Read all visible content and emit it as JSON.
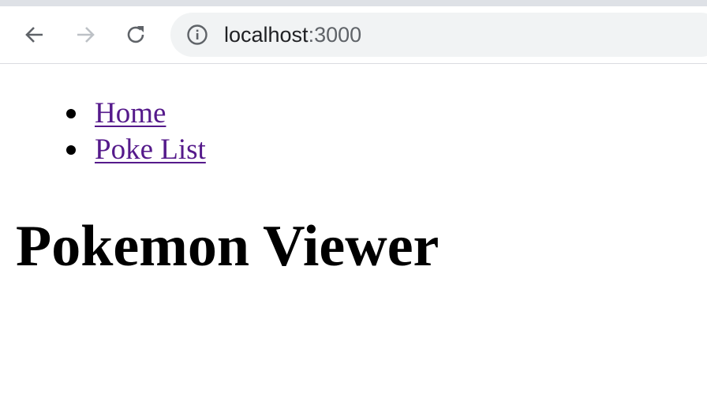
{
  "browser": {
    "url_host": "localhost",
    "url_port": ":3000",
    "icons": {
      "back": "arrow-left-icon",
      "forward": "arrow-right-icon",
      "reload": "reload-icon",
      "site_info": "info-icon"
    },
    "colors": {
      "icon_active": "#5f6368",
      "icon_disabled": "#bdc1c6",
      "omnibox_bg": "#f1f3f4"
    }
  },
  "page": {
    "nav": [
      {
        "label": "Home"
      },
      {
        "label": "Poke List"
      }
    ],
    "title": "Pokemon Viewer",
    "colors": {
      "link": "#551a8b",
      "text": "#000000"
    }
  }
}
